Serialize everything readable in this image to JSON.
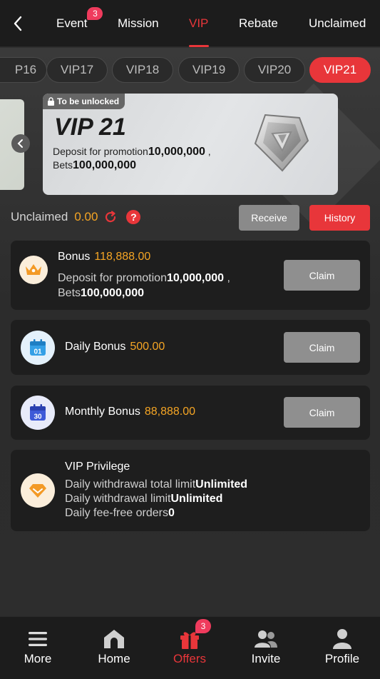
{
  "header": {
    "tabs": [
      {
        "label": "Event",
        "badge": "3"
      },
      {
        "label": "Mission"
      },
      {
        "label": "VIP",
        "active": true
      },
      {
        "label": "Rebate"
      },
      {
        "label": "Unclaimed"
      }
    ]
  },
  "vip_levels": [
    "P16",
    "VIP17",
    "VIP18",
    "VIP19",
    "VIP20",
    "VIP21"
  ],
  "selected_level": "VIP21",
  "vip_card": {
    "lock_label": "To be unlocked",
    "title": "VIP 21",
    "deposit_label": "Deposit for promotion",
    "deposit_value": "10,000,000",
    "bets_label": "Bets",
    "bets_value": "100,000,000"
  },
  "summary": {
    "unclaimed_label": "Unclaimed",
    "unclaimed_value": "0.00",
    "help_label": "?",
    "receive_label": "Receive",
    "history_label": "History"
  },
  "bonus": {
    "title": "Bonus",
    "amount": "118,888.00",
    "deposit_label": "Deposit for promotion",
    "deposit_value": "10,000,000",
    "deposit_suffix": " ,",
    "bets_label": "Bets",
    "bets_value": "100,000,000",
    "claim_label": "Claim",
    "icon": "crown-icon"
  },
  "daily_bonus": {
    "title": "Daily Bonus",
    "amount": "500.00",
    "claim_label": "Claim",
    "calendar_day": "01",
    "icon": "calendar-icon"
  },
  "monthly_bonus": {
    "title": "Monthly Bonus",
    "amount": "88,888.00",
    "claim_label": "Claim",
    "calendar_day": "30",
    "icon": "calendar-icon"
  },
  "privilege": {
    "title": "VIP Privilege",
    "rows": [
      {
        "label": "Daily withdrawal total limit",
        "value": "Unlimited"
      },
      {
        "label": "Daily withdrawal limit",
        "value": "Unlimited"
      },
      {
        "label": "Daily fee-free orders",
        "value": "0"
      }
    ],
    "icon": "diamond-icon"
  },
  "bottom_nav": {
    "items": [
      {
        "label": "More",
        "icon": "menu-icon"
      },
      {
        "label": "Home",
        "icon": "home-icon"
      },
      {
        "label": "Offers",
        "icon": "gift-icon",
        "badge": "3",
        "active": true
      },
      {
        "label": "Invite",
        "icon": "users-icon"
      },
      {
        "label": "Profile",
        "icon": "user-icon"
      }
    ]
  },
  "colors": {
    "accent": "#e8363a",
    "amount": "#f5a524",
    "card_bg": "#1e1e1e",
    "page_bg": "#2f2f2f",
    "badge": "#ef3b5d"
  }
}
